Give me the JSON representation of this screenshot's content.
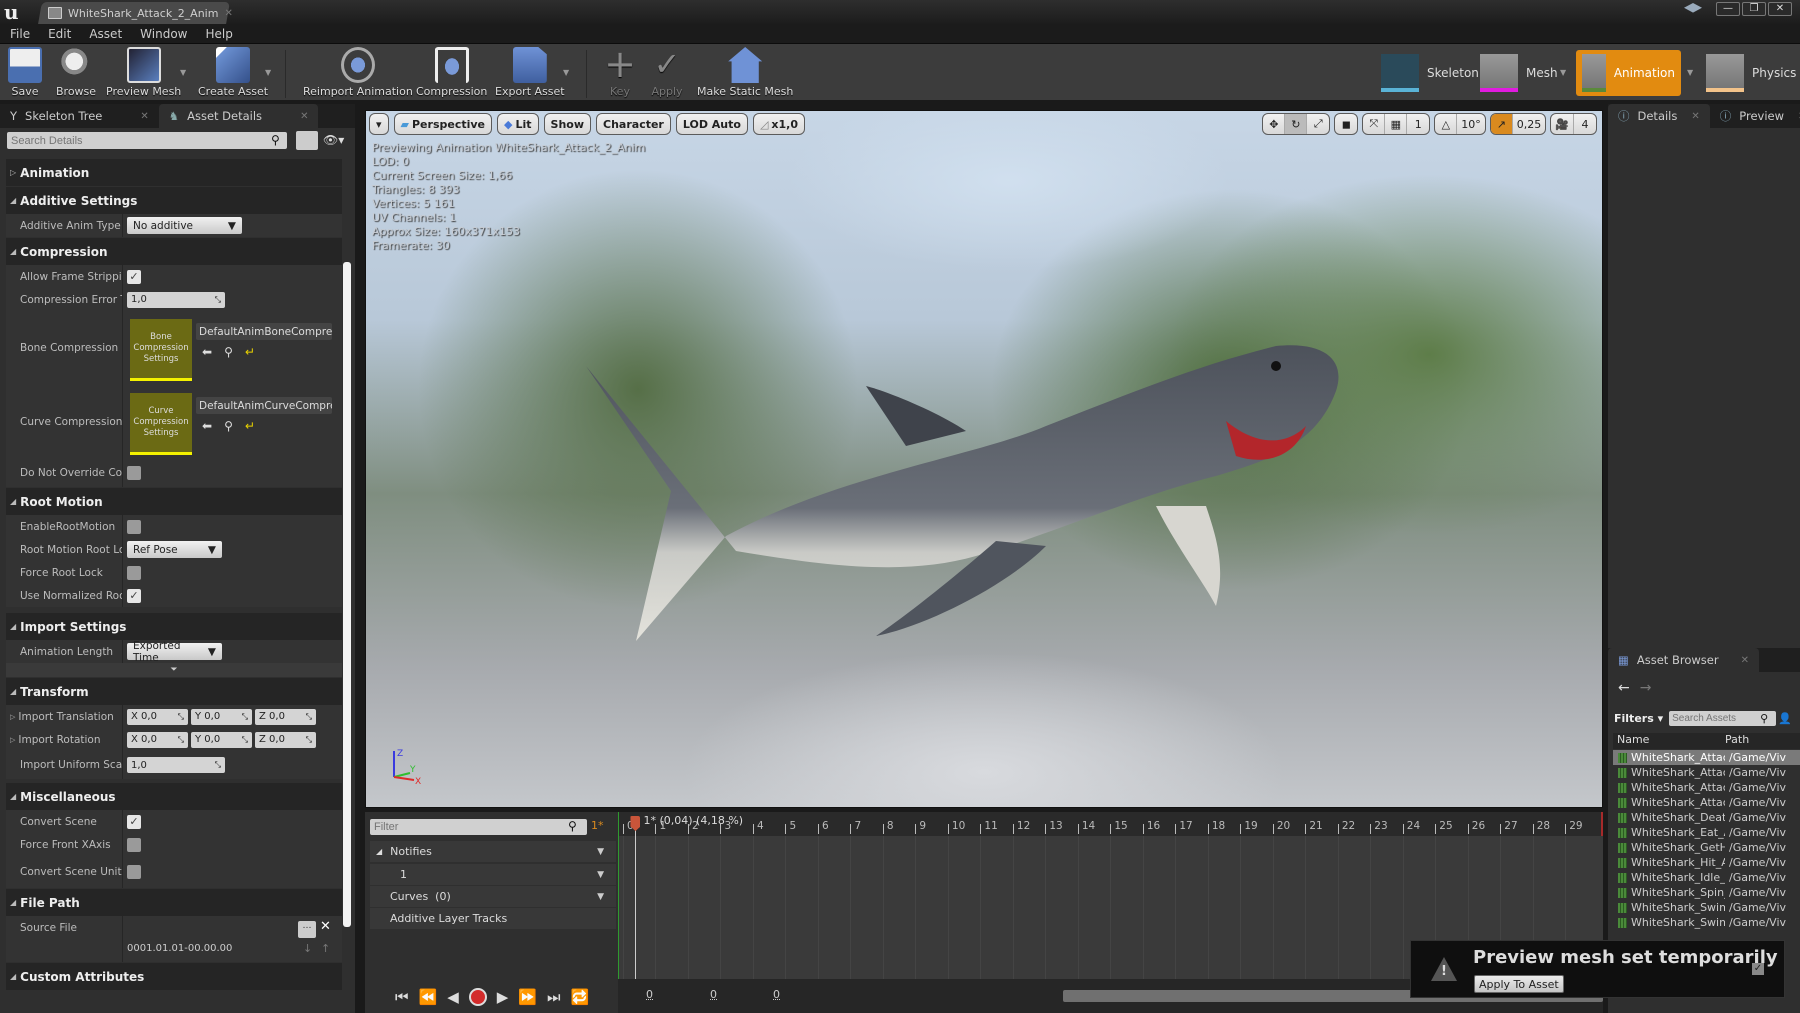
{
  "window": {
    "tab_title": "WhiteShark_Attack_2_Anim",
    "controls": [
      "—",
      "❐",
      "✕"
    ]
  },
  "menu": [
    "File",
    "Edit",
    "Asset",
    "Window",
    "Help"
  ],
  "toolbar": {
    "buttons": [
      {
        "label": "Save",
        "icon": "save-icon"
      },
      {
        "label": "Browse",
        "icon": "browse-icon"
      },
      {
        "label": "Preview Mesh",
        "icon": "preview-mesh-icon"
      },
      {
        "label": "Create Asset",
        "icon": "create-asset-icon"
      },
      {
        "label": "Reimport Animation",
        "icon": "reimport-icon"
      },
      {
        "label": "Compression",
        "icon": "compression-icon"
      },
      {
        "label": "Export Asset",
        "icon": "export-icon"
      },
      {
        "label": "Key",
        "icon": "key-plus-icon"
      },
      {
        "label": "Apply",
        "icon": "apply-check-icon"
      },
      {
        "label": "Make Static Mesh",
        "icon": "static-mesh-icon"
      }
    ],
    "modes": [
      {
        "label": "Skeleton",
        "accent": "#5ab3d6",
        "active": false
      },
      {
        "label": "Mesh",
        "accent": "#e11be0",
        "active": false
      },
      {
        "label": "Animation",
        "accent": "#5a8a3a",
        "active": true
      },
      {
        "label": "Physics",
        "accent": "#f3c38a",
        "active": false
      }
    ],
    "active_color": "#e28b10"
  },
  "left_panel": {
    "tabs": [
      {
        "label": "Skeleton Tree",
        "active": false
      },
      {
        "label": "Asset Details",
        "active": true
      }
    ],
    "search_placeholder": "Search Details",
    "categories": {
      "animation": "Animation",
      "additive": {
        "title": "Additive Settings",
        "additive_anim_type": {
          "label": "Additive Anim Type",
          "value": "No additive"
        }
      },
      "compression": {
        "title": "Compression",
        "allow_frame_stripping": {
          "label": "Allow Frame Stripping",
          "checked": true
        },
        "compression_error": {
          "label": "Compression Error Threshold",
          "value": "1,0"
        },
        "bone_compression": {
          "label": "Bone Compression Settings",
          "thumb": "Bone Compression Settings",
          "value": "DefaultAnimBoneCompressionSettings"
        },
        "curve_compression": {
          "label": "Curve Compression Settings",
          "thumb": "Curve Compression Settings",
          "value": "DefaultAnimCurveCompressionSettings"
        },
        "do_not_override": {
          "label": "Do Not Override Compression",
          "checked": false
        }
      },
      "root_motion": {
        "title": "Root Motion",
        "enable": {
          "label": "EnableRootMotion",
          "checked": false
        },
        "root_lock": {
          "label": "Root Motion Root Lock",
          "value": "Ref Pose"
        },
        "force_root_lock": {
          "label": "Force Root Lock",
          "checked": false
        },
        "use_normalized": {
          "label": "Use Normalized Root Motion Scale",
          "checked": true
        }
      },
      "import": {
        "title": "Import Settings",
        "anim_length": {
          "label": "Animation Length",
          "value": "Exported Time"
        }
      },
      "transform": {
        "title": "Transform",
        "translation": {
          "label": "Import Translation",
          "x": "0,0",
          "y": "0,0",
          "z": "0,0"
        },
        "rotation": {
          "label": "Import Rotation",
          "x": "0,0",
          "y": "0,0",
          "z": "0,0"
        },
        "scale": {
          "label": "Import Uniform Scale",
          "value": "1,0"
        }
      },
      "misc": {
        "title": "Miscellaneous",
        "convert_scene": {
          "label": "Convert Scene",
          "checked": true
        },
        "force_front": {
          "label": "Force Front XAxis",
          "checked": false
        },
        "convert_unit": {
          "label": "Convert Scene Unit",
          "checked": false
        }
      },
      "file_path": {
        "title": "File Path",
        "source_file": {
          "label": "Source File",
          "timestamp": "0001.01.01-00.00.00"
        }
      },
      "custom": "Custom Attributes"
    }
  },
  "viewport": {
    "menu": "▾",
    "buttons": [
      "Perspective",
      "Lit",
      "Show",
      "Character",
      "LOD Auto",
      "x1,0"
    ],
    "right": {
      "grid_snap": "1",
      "rot_snap": "10°",
      "scale_snap": "0,25",
      "cam_speed": "4"
    },
    "info": [
      "Previewing Animation WhiteShark_Attack_2_Anim",
      "LOD: 0",
      "Current Screen Size: 1,66",
      "Triangles: 8 393",
      "Vertices: 5 161",
      "UV Channels: 1",
      "Approx Size: 160x371x153",
      "Framerate: 30"
    ],
    "axis": {
      "x": "X",
      "y": "Y",
      "z": "Z"
    }
  },
  "sequencer": {
    "filter_placeholder": "Filter",
    "frame_marker": "1*",
    "tracks": [
      {
        "label": "Notifies"
      },
      {
        "label": "1"
      },
      {
        "label": "Curves  (0)"
      },
      {
        "label": "Additive Layer Tracks"
      }
    ],
    "playhead_label": "1* (0,04) (4,18 %)",
    "ticks": [
      "0",
      "1",
      "2",
      "3",
      "4",
      "5",
      "6",
      "7",
      "8",
      "9",
      "10",
      "11",
      "12",
      "13",
      "14",
      "15",
      "16",
      "17",
      "18",
      "19",
      "20",
      "21",
      "22",
      "23",
      "24",
      "25",
      "26",
      "27",
      "28",
      "29"
    ],
    "current_frame": 1,
    "total_frames": 30,
    "zoom_values": [
      "0",
      "0",
      "0"
    ]
  },
  "right_panel": {
    "tabs": [
      {
        "label": "Details"
      },
      {
        "label": "Preview"
      }
    ],
    "asset_browser": {
      "title": "Asset Browser",
      "filters": "Filters",
      "search_placeholder": "Search Assets",
      "columns": [
        "Name",
        "Path"
      ],
      "items": [
        {
          "name": "WhiteShark_Attack",
          "path": "/Game/Viv",
          "selected": true
        },
        {
          "name": "WhiteShark_Attack",
          "path": "/Game/Viv"
        },
        {
          "name": "WhiteShark_Attack",
          "path": "/Game/Viv"
        },
        {
          "name": "WhiteShark_Attack",
          "path": "/Game/Viv"
        },
        {
          "name": "WhiteShark_Death_",
          "path": "/Game/Viv"
        },
        {
          "name": "WhiteShark_Eat_An",
          "path": "/Game/Viv"
        },
        {
          "name": "WhiteShark_GetHit_",
          "path": "/Game/Viv"
        },
        {
          "name": "WhiteShark_Hit_An",
          "path": "/Game/Viv"
        },
        {
          "name": "WhiteShark_Idle_An",
          "path": "/Game/Viv"
        },
        {
          "name": "WhiteShark_Spin_A",
          "path": "/Game/Viv"
        },
        {
          "name": "WhiteShark_Swim_",
          "path": "/Game/Viv"
        },
        {
          "name": "WhiteShark_SwimS",
          "path": "/Game/Viv"
        }
      ]
    }
  },
  "toast": {
    "message": "Preview mesh set temporarily",
    "button": "Apply To Asset"
  }
}
